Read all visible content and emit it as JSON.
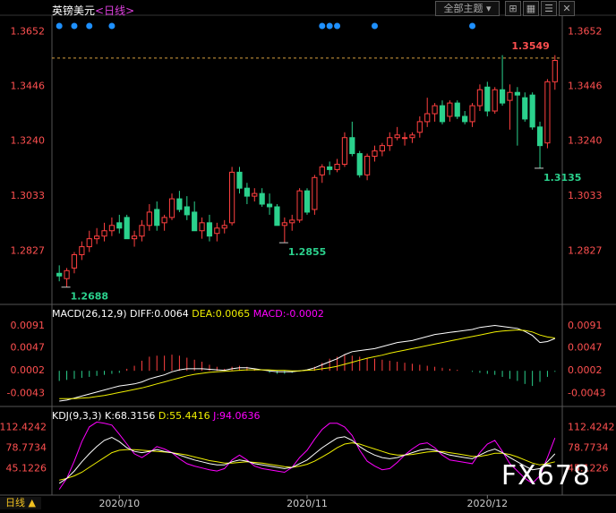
{
  "header": {
    "symbol_title": "英镑美元",
    "period_suffix": "<日线>",
    "theme_button": "全部主题",
    "period_button": "日线 ▲"
  },
  "colors": {
    "up": "#ff4040",
    "down": "#2bd18d",
    "axis_up": "#ff5050",
    "macd_diff": "#ffffff",
    "macd_dea": "#f0f000",
    "macd_bar": "#ff00ff",
    "kdj_k": "#ffffff",
    "kdj_d": "#f0f000",
    "kdj_j": "#ff00ff",
    "dot": "#1e90ff"
  },
  "watermark": "FX678",
  "chart_data": [
    {
      "type": "candlestick",
      "name": "price",
      "y_ticks": [
        "1.3652",
        "1.3446",
        "1.3240",
        "1.3033",
        "1.2827"
      ],
      "y_tick_values": [
        1.3652,
        1.3446,
        1.324,
        1.3033,
        1.2827
      ],
      "ylim": [
        1.264,
        1.37
      ],
      "x_ticks": [
        "2020/10",
        "2020/11",
        "2020/12"
      ],
      "x_tick_index": [
        8,
        33,
        57
      ],
      "annotations": [
        {
          "text": "1.3549",
          "value": 1.3549,
          "index": 66,
          "kind": "high"
        },
        {
          "text": "1.3135",
          "value": 1.3135,
          "index": 64,
          "kind": "low"
        },
        {
          "text": "1.2855",
          "value": 1.2855,
          "index": 30,
          "kind": "low"
        },
        {
          "text": "1.2688",
          "value": 1.2688,
          "index": 1,
          "kind": "low"
        }
      ],
      "reference_line": 1.3549,
      "dot_indices": [
        0,
        2,
        4,
        7,
        35,
        36,
        37,
        42,
        55
      ],
      "candles": [
        [
          1.274,
          1.277,
          1.271,
          1.273
        ],
        [
          1.272,
          1.276,
          1.2688,
          1.275
        ],
        [
          1.276,
          1.282,
          1.274,
          1.281
        ],
        [
          1.281,
          1.286,
          1.279,
          1.284
        ],
        [
          1.284,
          1.29,
          1.282,
          1.287
        ],
        [
          1.287,
          1.291,
          1.285,
          1.288
        ],
        [
          1.288,
          1.293,
          1.286,
          1.29
        ],
        [
          1.29,
          1.295,
          1.288,
          1.292
        ],
        [
          1.293,
          1.296,
          1.289,
          1.291
        ],
        [
          1.295,
          1.296,
          1.287,
          1.287
        ],
        [
          1.287,
          1.29,
          1.284,
          1.288
        ],
        [
          1.288,
          1.294,
          1.286,
          1.292
        ],
        [
          1.292,
          1.3,
          1.29,
          1.297
        ],
        [
          1.298,
          1.301,
          1.29,
          1.292
        ],
        [
          1.293,
          1.296,
          1.29,
          1.295
        ],
        [
          1.295,
          1.304,
          1.294,
          1.302
        ],
        [
          1.302,
          1.305,
          1.297,
          1.298
        ],
        [
          1.299,
          1.303,
          1.294,
          1.296
        ],
        [
          1.297,
          1.301,
          1.29,
          1.29
        ],
        [
          1.29,
          1.295,
          1.287,
          1.293
        ],
        [
          1.293,
          1.296,
          1.286,
          1.288
        ],
        [
          1.289,
          1.293,
          1.286,
          1.291
        ],
        [
          1.291,
          1.294,
          1.289,
          1.292
        ],
        [
          1.293,
          1.314,
          1.292,
          1.312
        ],
        [
          1.312,
          1.314,
          1.304,
          1.306
        ],
        [
          1.306,
          1.308,
          1.3,
          1.303
        ],
        [
          1.303,
          1.306,
          1.301,
          1.304
        ],
        [
          1.304,
          1.306,
          1.299,
          1.3
        ],
        [
          1.3,
          1.304,
          1.296,
          1.299
        ],
        [
          1.299,
          1.3,
          1.292,
          1.292
        ],
        [
          1.292,
          1.295,
          1.2855,
          1.293
        ],
        [
          1.293,
          1.296,
          1.29,
          1.294
        ],
        [
          1.294,
          1.306,
          1.293,
          1.305
        ],
        [
          1.305,
          1.306,
          1.296,
          1.297
        ],
        [
          1.298,
          1.311,
          1.296,
          1.31
        ],
        [
          1.311,
          1.315,
          1.308,
          1.314
        ],
        [
          1.314,
          1.316,
          1.311,
          1.313
        ],
        [
          1.313,
          1.317,
          1.312,
          1.315
        ],
        [
          1.315,
          1.327,
          1.314,
          1.325
        ],
        [
          1.325,
          1.331,
          1.318,
          1.319
        ],
        [
          1.319,
          1.32,
          1.31,
          1.311
        ],
        [
          1.311,
          1.319,
          1.309,
          1.318
        ],
        [
          1.318,
          1.322,
          1.316,
          1.32
        ],
        [
          1.32,
          1.323,
          1.318,
          1.322
        ],
        [
          1.322,
          1.327,
          1.32,
          1.325
        ],
        [
          1.325,
          1.329,
          1.324,
          1.326
        ],
        [
          1.325,
          1.327,
          1.322,
          1.325
        ],
        [
          1.325,
          1.327,
          1.323,
          1.326
        ],
        [
          1.327,
          1.333,
          1.325,
          1.331
        ],
        [
          1.331,
          1.34,
          1.329,
          1.334
        ],
        [
          1.334,
          1.338,
          1.331,
          1.337
        ],
        [
          1.337,
          1.339,
          1.33,
          1.331
        ],
        [
          1.333,
          1.339,
          1.331,
          1.338
        ],
        [
          1.338,
          1.339,
          1.332,
          1.333
        ],
        [
          1.333,
          1.335,
          1.33,
          1.331
        ],
        [
          1.331,
          1.338,
          1.329,
          1.337
        ],
        [
          1.337,
          1.345,
          1.335,
          1.343
        ],
        [
          1.344,
          1.346,
          1.333,
          1.335
        ],
        [
          1.335,
          1.344,
          1.334,
          1.343
        ],
        [
          1.343,
          1.356,
          1.337,
          1.338
        ],
        [
          1.339,
          1.345,
          1.328,
          1.342
        ],
        [
          1.342,
          1.344,
          1.322,
          1.341
        ],
        [
          1.34,
          1.342,
          1.331,
          1.332
        ],
        [
          1.341,
          1.342,
          1.328,
          1.329
        ],
        [
          1.329,
          1.331,
          1.3135,
          1.322
        ],
        [
          1.323,
          1.347,
          1.321,
          1.346
        ],
        [
          1.346,
          1.356,
          1.343,
          1.354
        ]
      ]
    },
    {
      "type": "line+bar",
      "name": "MACD",
      "label": "MACD(26,12,9)",
      "readouts": [
        "DIFF:0.0064",
        "DEA:0.0065",
        "MACD:-0.0002"
      ],
      "y_ticks": [
        "0.0091",
        "0.0047",
        "0.0002",
        "-0.0043"
      ],
      "y_tick_values": [
        0.0091,
        0.0047,
        0.0002,
        -0.0043
      ],
      "ylim": [
        -0.006,
        0.0105
      ],
      "series": [
        {
          "name": "DIFF",
          "values": [
            -0.006,
            -0.0058,
            -0.0054,
            -0.005,
            -0.0046,
            -0.0042,
            -0.0038,
            -0.0034,
            -0.003,
            -0.0028,
            -0.0026,
            -0.0022,
            -0.0016,
            -0.0012,
            -0.0008,
            -0.0002,
            0.0002,
            0.0004,
            0.0004,
            0.0004,
            0.0003,
            0.0002,
            0.0001,
            0.0004,
            0.0006,
            0.0006,
            0.0004,
            0.0002,
            0.0,
            -0.0002,
            -0.0002,
            -0.0002,
            0.0,
            0.0002,
            0.0006,
            0.0012,
            0.0018,
            0.0024,
            0.0032,
            0.0038,
            0.004,
            0.0042,
            0.0044,
            0.0048,
            0.0052,
            0.0056,
            0.0058,
            0.006,
            0.0064,
            0.0068,
            0.0072,
            0.0074,
            0.0076,
            0.0078,
            0.008,
            0.0082,
            0.0086,
            0.0088,
            0.009,
            0.0088,
            0.0086,
            0.0084,
            0.0078,
            0.007,
            0.0056,
            0.0058,
            0.0064
          ]
        },
        {
          "name": "DEA",
          "values": [
            -0.0055,
            -0.0055,
            -0.0055,
            -0.0054,
            -0.0053,
            -0.0051,
            -0.0049,
            -0.0046,
            -0.0043,
            -0.004,
            -0.0037,
            -0.0034,
            -0.003,
            -0.0026,
            -0.0022,
            -0.0018,
            -0.0014,
            -0.001,
            -0.0007,
            -0.0005,
            -0.0003,
            -0.0002,
            -0.0001,
            0.0,
            0.0001,
            0.0002,
            0.0002,
            0.0002,
            0.0002,
            0.0001,
            0.0001,
            0.0,
            0.0,
            0.0001,
            0.0002,
            0.0004,
            0.0006,
            0.0009,
            0.0013,
            0.0017,
            0.0021,
            0.0025,
            0.0028,
            0.0031,
            0.0035,
            0.0038,
            0.0041,
            0.0044,
            0.0047,
            0.005,
            0.0053,
            0.0056,
            0.0059,
            0.0062,
            0.0065,
            0.0068,
            0.0071,
            0.0074,
            0.0077,
            0.0079,
            0.008,
            0.0081,
            0.008,
            0.0077,
            0.0071,
            0.0067,
            0.0065
          ]
        },
        {
          "name": "MACD",
          "values": [
            -0.002,
            -0.0018,
            -0.0016,
            -0.0014,
            -0.0012,
            -0.001,
            -0.0008,
            -0.0006,
            -0.0004,
            0.0004,
            0.001,
            0.002,
            0.0028,
            0.003,
            0.003,
            0.0032,
            0.003,
            0.0026,
            0.0022,
            0.0018,
            0.0012,
            0.0008,
            0.0004,
            0.0008,
            0.001,
            0.0008,
            0.0004,
            0.0,
            -0.0004,
            -0.0006,
            -0.0006,
            -0.0004,
            0.0,
            0.0002,
            0.0008,
            0.0016,
            0.0024,
            0.0028,
            0.0032,
            0.003,
            0.0028,
            0.0026,
            0.0024,
            0.0022,
            0.002,
            0.0018,
            0.0016,
            0.0014,
            0.0012,
            0.001,
            0.0008,
            0.0006,
            0.0004,
            0.0002,
            0.0,
            -0.0002,
            -0.0004,
            -0.0006,
            -0.0008,
            -0.0012,
            -0.0016,
            -0.002,
            -0.0026,
            -0.003,
            -0.0022,
            -0.0012,
            -0.0002
          ]
        }
      ]
    },
    {
      "type": "line",
      "name": "KDJ",
      "label": "KDJ(9,3,3)",
      "readouts": [
        "K:68.3156",
        "D:55.4416",
        "J:94.0636"
      ],
      "y_ticks": [
        "112.4242",
        "78.7734",
        "45.1226"
      ],
      "y_tick_values": [
        112.4242,
        78.7734,
        45.1226
      ],
      "ylim": [
        5,
        125
      ],
      "series": [
        {
          "name": "K",
          "values": [
            20,
            28,
            40,
            55,
            68,
            80,
            90,
            95,
            88,
            78,
            72,
            70,
            72,
            75,
            72,
            70,
            66,
            62,
            58,
            55,
            52,
            50,
            50,
            55,
            58,
            56,
            52,
            50,
            48,
            46,
            44,
            46,
            52,
            58,
            68,
            78,
            86,
            94,
            96,
            90,
            80,
            72,
            66,
            62,
            60,
            62,
            66,
            70,
            74,
            76,
            74,
            70,
            66,
            64,
            62,
            60,
            66,
            72,
            76,
            70,
            62,
            55,
            48,
            42,
            44,
            55,
            68
          ]
        },
        {
          "name": "D",
          "values": [
            25,
            28,
            32,
            38,
            46,
            54,
            62,
            70,
            74,
            75,
            75,
            74,
            73,
            72,
            71,
            70,
            68,
            66,
            63,
            60,
            57,
            55,
            53,
            53,
            54,
            55,
            54,
            53,
            51,
            49,
            47,
            46,
            48,
            51,
            56,
            63,
            70,
            78,
            84,
            86,
            84,
            80,
            76,
            72,
            68,
            66,
            66,
            67,
            69,
            71,
            72,
            72,
            70,
            68,
            66,
            64,
            64,
            66,
            69,
            69,
            67,
            63,
            58,
            53,
            50,
            52,
            55
          ]
        },
        {
          "name": "J",
          "values": [
            10,
            28,
            56,
            88,
            112,
            120,
            118,
            115,
            100,
            84,
            68,
            62,
            70,
            80,
            76,
            70,
            60,
            52,
            48,
            45,
            42,
            40,
            44,
            58,
            66,
            58,
            48,
            44,
            42,
            40,
            38,
            46,
            62,
            74,
            92,
            108,
            118,
            118,
            112,
            98,
            74,
            56,
            48,
            42,
            44,
            54,
            66,
            76,
            84,
            86,
            78,
            66,
            58,
            56,
            54,
            52,
            70,
            84,
            90,
            72,
            52,
            40,
            28,
            20,
            32,
            62,
            94
          ]
        }
      ]
    }
  ]
}
